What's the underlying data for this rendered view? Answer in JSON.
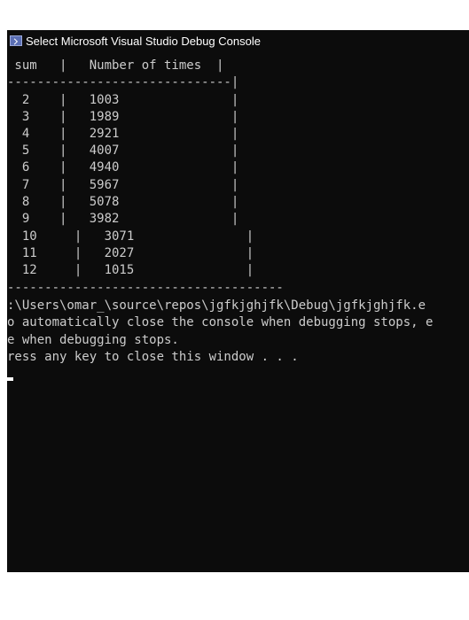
{
  "window": {
    "title": "Select Microsoft Visual Studio Debug Console",
    "icon": "console-app-icon"
  },
  "console": {
    "lines": [
      " sum   |   Number of times  |",
      "------------------------------|",
      "  2    |   1003               |",
      "  3    |   1989               |",
      "  4    |   2921               |",
      "  5    |   4007               |",
      "  6    |   4940               |",
      "  7    |   5967               |",
      "  8    |   5078               |",
      "  9    |   3982               |",
      "  10     |   3071               |",
      "  11     |   2027               |",
      "  12     |   1015               |",
      "-------------------------------------",
      ":\\Users\\omar_\\source\\repos\\jgfkjghjfk\\Debug\\jgfkjghjfk.e",
      "o automatically close the console when debugging stops, e",
      "e when debugging stops.",
      "ress any key to close this window . . ."
    ]
  },
  "colors": {
    "console_background": "#0c0c0c",
    "console_text": "#cccccc"
  }
}
